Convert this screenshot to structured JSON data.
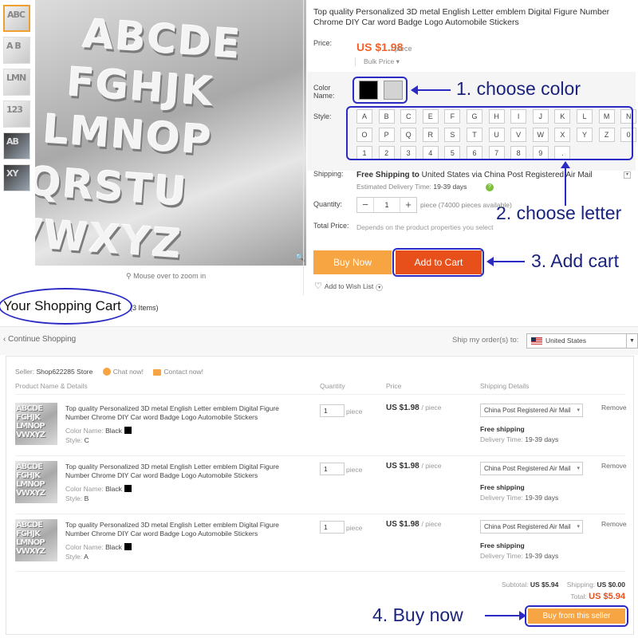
{
  "product": {
    "title": "Top quality Personalized 3D metal English Letter emblem Digital Figure Number Chrome DIY Car word Badge Logo Automobile Stickers",
    "zoom_hint": "Mouse over to zoom in",
    "image_rows": [
      "ABCDE",
      "FGHJK",
      "LMNOP",
      "QRSTU",
      "VWXYZ"
    ],
    "price_label": "Price:",
    "price": "US $1.98",
    "price_unit": "/ piece",
    "bulk_price": "Bulk Price",
    "color_label": "Color Name:",
    "colors": [
      {
        "name": "Black",
        "hex": "#000000"
      },
      {
        "name": "Silver",
        "hex": "#d3d3d3"
      }
    ],
    "style_label": "Style:",
    "styles": [
      "A",
      "B",
      "C",
      "E",
      "F",
      "G",
      "H",
      "I",
      "J",
      "K",
      "L",
      "M",
      "N",
      "O",
      "P",
      "Q",
      "R",
      "S",
      "T",
      "U",
      "V",
      "W",
      "X",
      "Y",
      "Z",
      "0",
      "1",
      "2",
      "3",
      "4",
      "5",
      "6",
      "7",
      "8",
      "9",
      "."
    ],
    "shipping_label": "Shipping:",
    "shipping_bold": "Free Shipping to",
    "shipping_rest": "United States via China Post Registered Air Mail",
    "delivery_label": "Estimated Delivery Time:",
    "delivery_days": "19-39 days",
    "quantity_label": "Quantity:",
    "quantity": "1",
    "quantity_note": "piece (74000 pieces available)",
    "total_label": "Total Price:",
    "total_note": "Depends on the product properties you select",
    "buy_now": "Buy Now",
    "add_to_cart": "Add to Cart",
    "wish_list": "Add to Wish List"
  },
  "annotations": {
    "step1": "1. choose color",
    "step2": "2. choose letter",
    "step3": "3. Add cart",
    "step4": "4. Buy now"
  },
  "cart": {
    "title": "Your Shopping Cart",
    "count": "(3 Items)",
    "continue": "Continue Shopping",
    "ship_to_label": "Ship my order(s) to:",
    "country": "United States",
    "seller_label": "Seller:",
    "store": "Shop622285 Store",
    "chat": "Chat now!",
    "contact": "Contact now!",
    "columns": {
      "product": "Product Name & Details",
      "quantity": "Quantity",
      "price": "Price",
      "shipping": "Shipping Details"
    },
    "items": [
      {
        "title": "Top quality Personalized 3D metal English Letter emblem Digital Figure Number Chrome DIY Car word Badge Logo Automobile Stickers",
        "color_label": "Color Name:",
        "color": "Black",
        "style_label": "Style:",
        "style": "C",
        "qty": "1",
        "unit": "piece",
        "price": "US $1.98",
        "price_unit": "/ piece",
        "method": "China Post Registered Air Mail",
        "free": "Free shipping",
        "delivery_label": "Delivery Time:",
        "delivery": "19-39 days",
        "remove": "Remove"
      },
      {
        "title": "Top quality Personalized 3D metal English Letter emblem Digital Figure Number Chrome DIY Car word Badge Logo Automobile Stickers",
        "color_label": "Color Name:",
        "color": "Black",
        "style_label": "Style:",
        "style": "B",
        "qty": "1",
        "unit": "piece",
        "price": "US $1.98",
        "price_unit": "/ piece",
        "method": "China Post Registered Air Mail",
        "free": "Free shipping",
        "delivery_label": "Delivery Time:",
        "delivery": "19-39 days",
        "remove": "Remove"
      },
      {
        "title": "Top quality Personalized 3D metal English Letter emblem Digital Figure Number Chrome DIY Car word Badge Logo Automobile Stickers",
        "color_label": "Color Name:",
        "color": "Black",
        "style_label": "Style:",
        "style": "A",
        "qty": "1",
        "unit": "piece",
        "price": "US $1.98",
        "price_unit": "/ piece",
        "method": "China Post Registered Air Mail",
        "free": "Free shipping",
        "delivery_label": "Delivery Time:",
        "delivery": "19-39 days",
        "remove": "Remove"
      }
    ],
    "subtotal_label": "Subtotal:",
    "subtotal": "US $5.94",
    "shipping_label": "Shipping:",
    "shipping": "US $0.00",
    "total_label": "Total:",
    "total": "US $5.94",
    "buy_button": "Buy from this seller"
  },
  "colors": {
    "accent_orange": "#f7a542",
    "cart_red": "#e8501b",
    "price_red": "#f2622a",
    "annotation_blue": "#2b2bc4"
  }
}
